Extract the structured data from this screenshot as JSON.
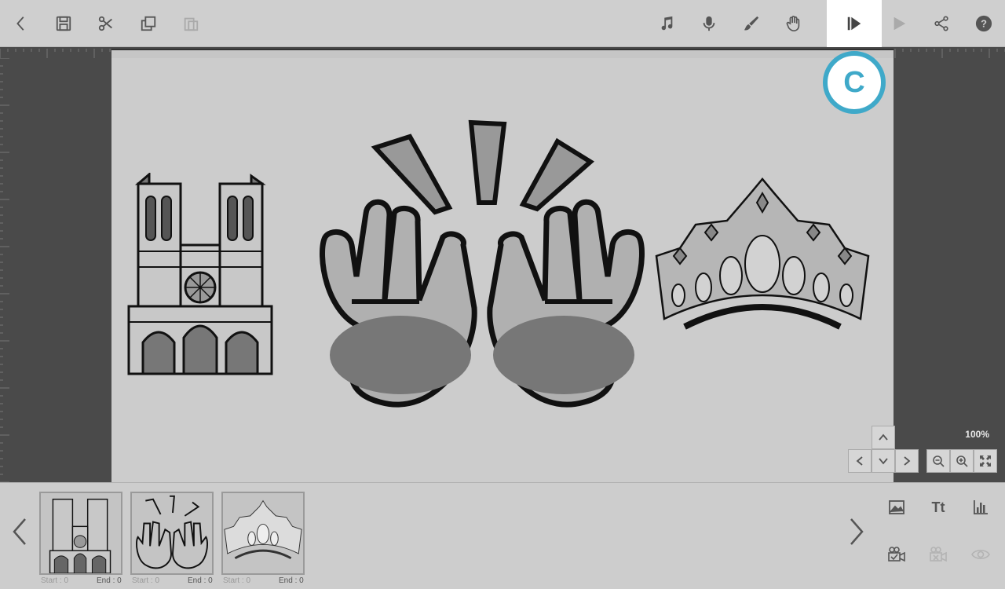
{
  "toolbar": {
    "icons": [
      "back-icon",
      "save-icon",
      "scissors-icon",
      "copy-icon",
      "paste-icon",
      "music-icon",
      "microphone-icon",
      "brush-icon",
      "hand-icon",
      "play-from-start-icon",
      "play-icon",
      "share-icon",
      "help-icon"
    ]
  },
  "badge": {
    "letter": "C",
    "color": "#3fa9c9"
  },
  "zoom": {
    "level": "100%"
  },
  "scenes": [
    {
      "name": "cathedral",
      "start_label": "Start : 0",
      "end_label": "End : 0"
    },
    {
      "name": "hands",
      "start_label": "Start : 0",
      "end_label": "End : 0"
    },
    {
      "name": "crown",
      "start_label": "Start : 0",
      "end_label": "End : 0"
    }
  ],
  "bottom": {
    "text_button": "Tt"
  }
}
